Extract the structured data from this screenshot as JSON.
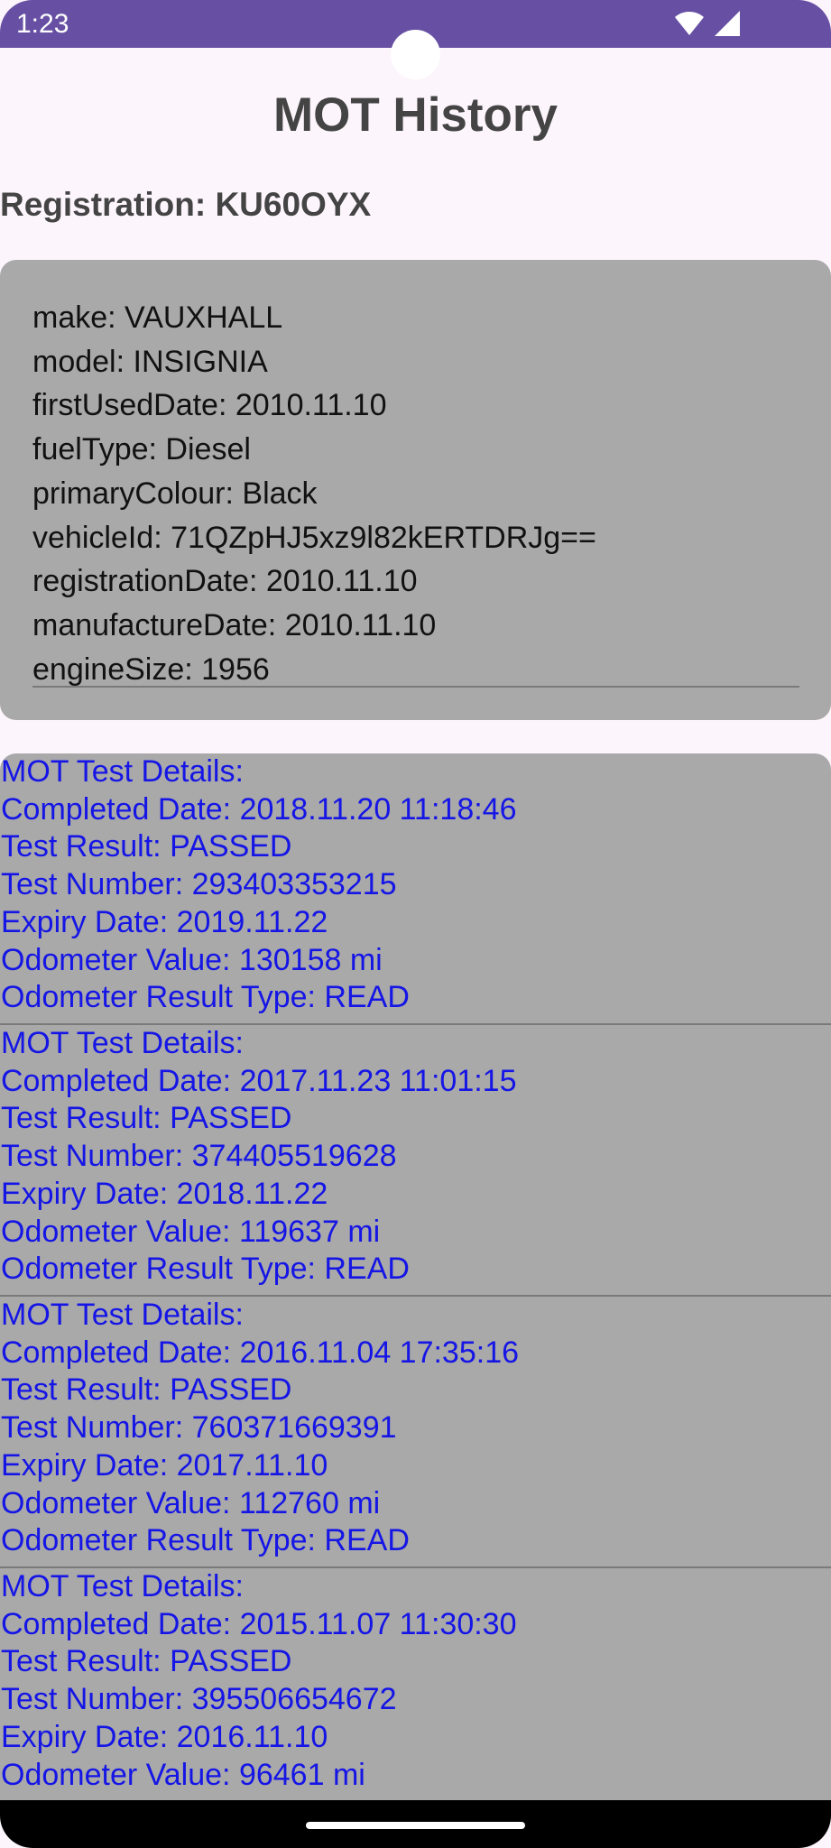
{
  "status_bar": {
    "time": "1:23",
    "icons": [
      "wifi-icon",
      "signal-icon"
    ],
    "color": "#6750a4"
  },
  "page": {
    "title": "MOT History",
    "registration": "Registration: KU60OYX"
  },
  "vehicle": {
    "lines": [
      "make: VAUXHALL",
      "model: INSIGNIA",
      "firstUsedDate: 2010.11.10",
      "fuelType: Diesel",
      "primaryColour: Black",
      "vehicleId: 71QZpHJ5xz9l82kERTDRJg==",
      "registrationDate: 2010.11.10",
      "manufactureDate: 2010.11.10",
      "engineSize: 1956"
    ]
  },
  "mot_tests": [
    {
      "heading": "MOT Test Details:",
      "completed": "Completed Date: 2018.11.20 11:18:46",
      "result": "Test Result: PASSED",
      "number": "Test Number: 293403353215",
      "expiry": "Expiry Date: 2019.11.22",
      "odometer": "Odometer Value: 130158 mi",
      "odometer_type": "Odometer Result Type: READ"
    },
    {
      "heading": "MOT Test Details:",
      "completed": "Completed Date: 2017.11.23 11:01:15",
      "result": "Test Result: PASSED",
      "number": "Test Number: 374405519628",
      "expiry": "Expiry Date: 2018.11.22",
      "odometer": "Odometer Value: 119637 mi",
      "odometer_type": "Odometer Result Type: READ"
    },
    {
      "heading": "MOT Test Details:",
      "completed": "Completed Date: 2016.11.04 17:35:16",
      "result": "Test Result: PASSED",
      "number": "Test Number: 760371669391",
      "expiry": "Expiry Date: 2017.11.10",
      "odometer": "Odometer Value: 112760 mi",
      "odometer_type": "Odometer Result Type: READ"
    },
    {
      "heading": "MOT Test Details:",
      "completed": "Completed Date: 2015.11.07 11:30:30",
      "result": "Test Result: PASSED",
      "number": "Test Number: 395506654672",
      "expiry": "Expiry Date: 2016.11.10",
      "odometer": "Odometer Value: 96461 mi"
    }
  ],
  "colors": {
    "accent": "#6750a4",
    "card": "#a9a9a9",
    "test_text": "#1515e6",
    "background": "#fdf5fc"
  }
}
